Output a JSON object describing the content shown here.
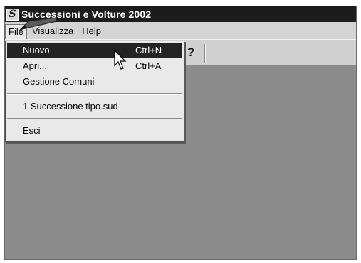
{
  "window": {
    "title": "Successioni e Volture 2002",
    "icon_letter": "S"
  },
  "menubar": {
    "items": [
      {
        "label": "File"
      },
      {
        "label": "Visualizza"
      },
      {
        "label": "Help"
      }
    ]
  },
  "toolbar": {
    "help_icon": "help-question-icon",
    "help_glyph": "?"
  },
  "file_menu": {
    "items": [
      {
        "label": "Nuovo",
        "shortcut": "Ctrl+N",
        "highlighted": true
      },
      {
        "label": "Apri...",
        "shortcut": "Ctrl+A"
      },
      {
        "label": "Gestione Comuni",
        "shortcut": ""
      },
      {
        "label": "1 Successione tipo.sud",
        "shortcut": ""
      },
      {
        "label": "Esci",
        "shortcut": ""
      }
    ]
  },
  "colors": {
    "titlebar": "#1c1c1c",
    "highlight": "#232323",
    "client_area": "#8c8c8c"
  }
}
